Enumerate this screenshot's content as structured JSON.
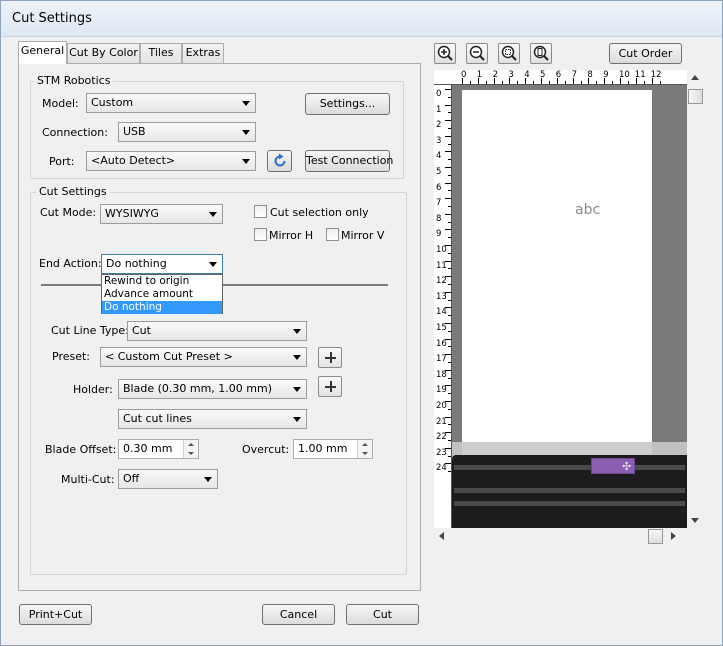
{
  "window": {
    "title": "Cut Settings"
  },
  "tabs": [
    {
      "label": "General"
    },
    {
      "label": "Cut By Color"
    },
    {
      "label": "Tiles"
    },
    {
      "label": "Extras"
    }
  ],
  "stm": {
    "group_title": "STM Robotics",
    "model_label": "Model:",
    "model_value": "Custom",
    "settings_button": "Settings...",
    "connection_label": "Connection:",
    "connection_value": "USB",
    "port_label": "Port:",
    "port_value": "<Auto Detect>",
    "test_button": "Test Connection"
  },
  "cut_settings": {
    "group_title": "Cut Settings",
    "cut_mode_label": "Cut Mode:",
    "cut_mode_value": "WYSIWYG",
    "cut_selection_only": "Cut selection only",
    "mirror_h": "Mirror H",
    "mirror_v": "Mirror V",
    "end_action_label": "End Action:",
    "end_action_value": "Do nothing",
    "end_action_options": [
      "Rewind to origin",
      "Advance amount",
      "Do nothing"
    ],
    "cut_line_type_label": "Cut Line Type:",
    "cut_line_type_value": "Cut",
    "preset_label": "Preset:",
    "preset_value": "< Custom Cut Preset >",
    "holder_label": "Holder:",
    "holder_value": "Blade (0.30 mm, 1.00 mm)",
    "cut_lines_value": "Cut cut lines",
    "blade_offset_label": "Blade Offset:",
    "blade_offset_value": "0.30 mm",
    "overcut_label": "Overcut:",
    "overcut_value": "1.00 mm",
    "multicut_label": "Multi-Cut:",
    "multicut_value": "Off"
  },
  "preview": {
    "cut_order_button": "Cut Order",
    "ruler_top_numbers": [
      "0",
      "1",
      "2",
      "3",
      "4",
      "5",
      "6",
      "7",
      "8",
      "9",
      "10",
      "11",
      "12"
    ],
    "ruler_left_numbers": [
      "0",
      "1",
      "2",
      "3",
      "4",
      "5",
      "6",
      "7",
      "8",
      "9",
      "10",
      "11",
      "12",
      "13",
      "14",
      "15",
      "16",
      "17",
      "18",
      "19",
      "20",
      "21",
      "22",
      "23",
      "24"
    ],
    "sample_text": "abc"
  },
  "footer": {
    "print_cut_button": "Print+Cut",
    "cancel_button": "Cancel",
    "cut_button": "Cut"
  }
}
